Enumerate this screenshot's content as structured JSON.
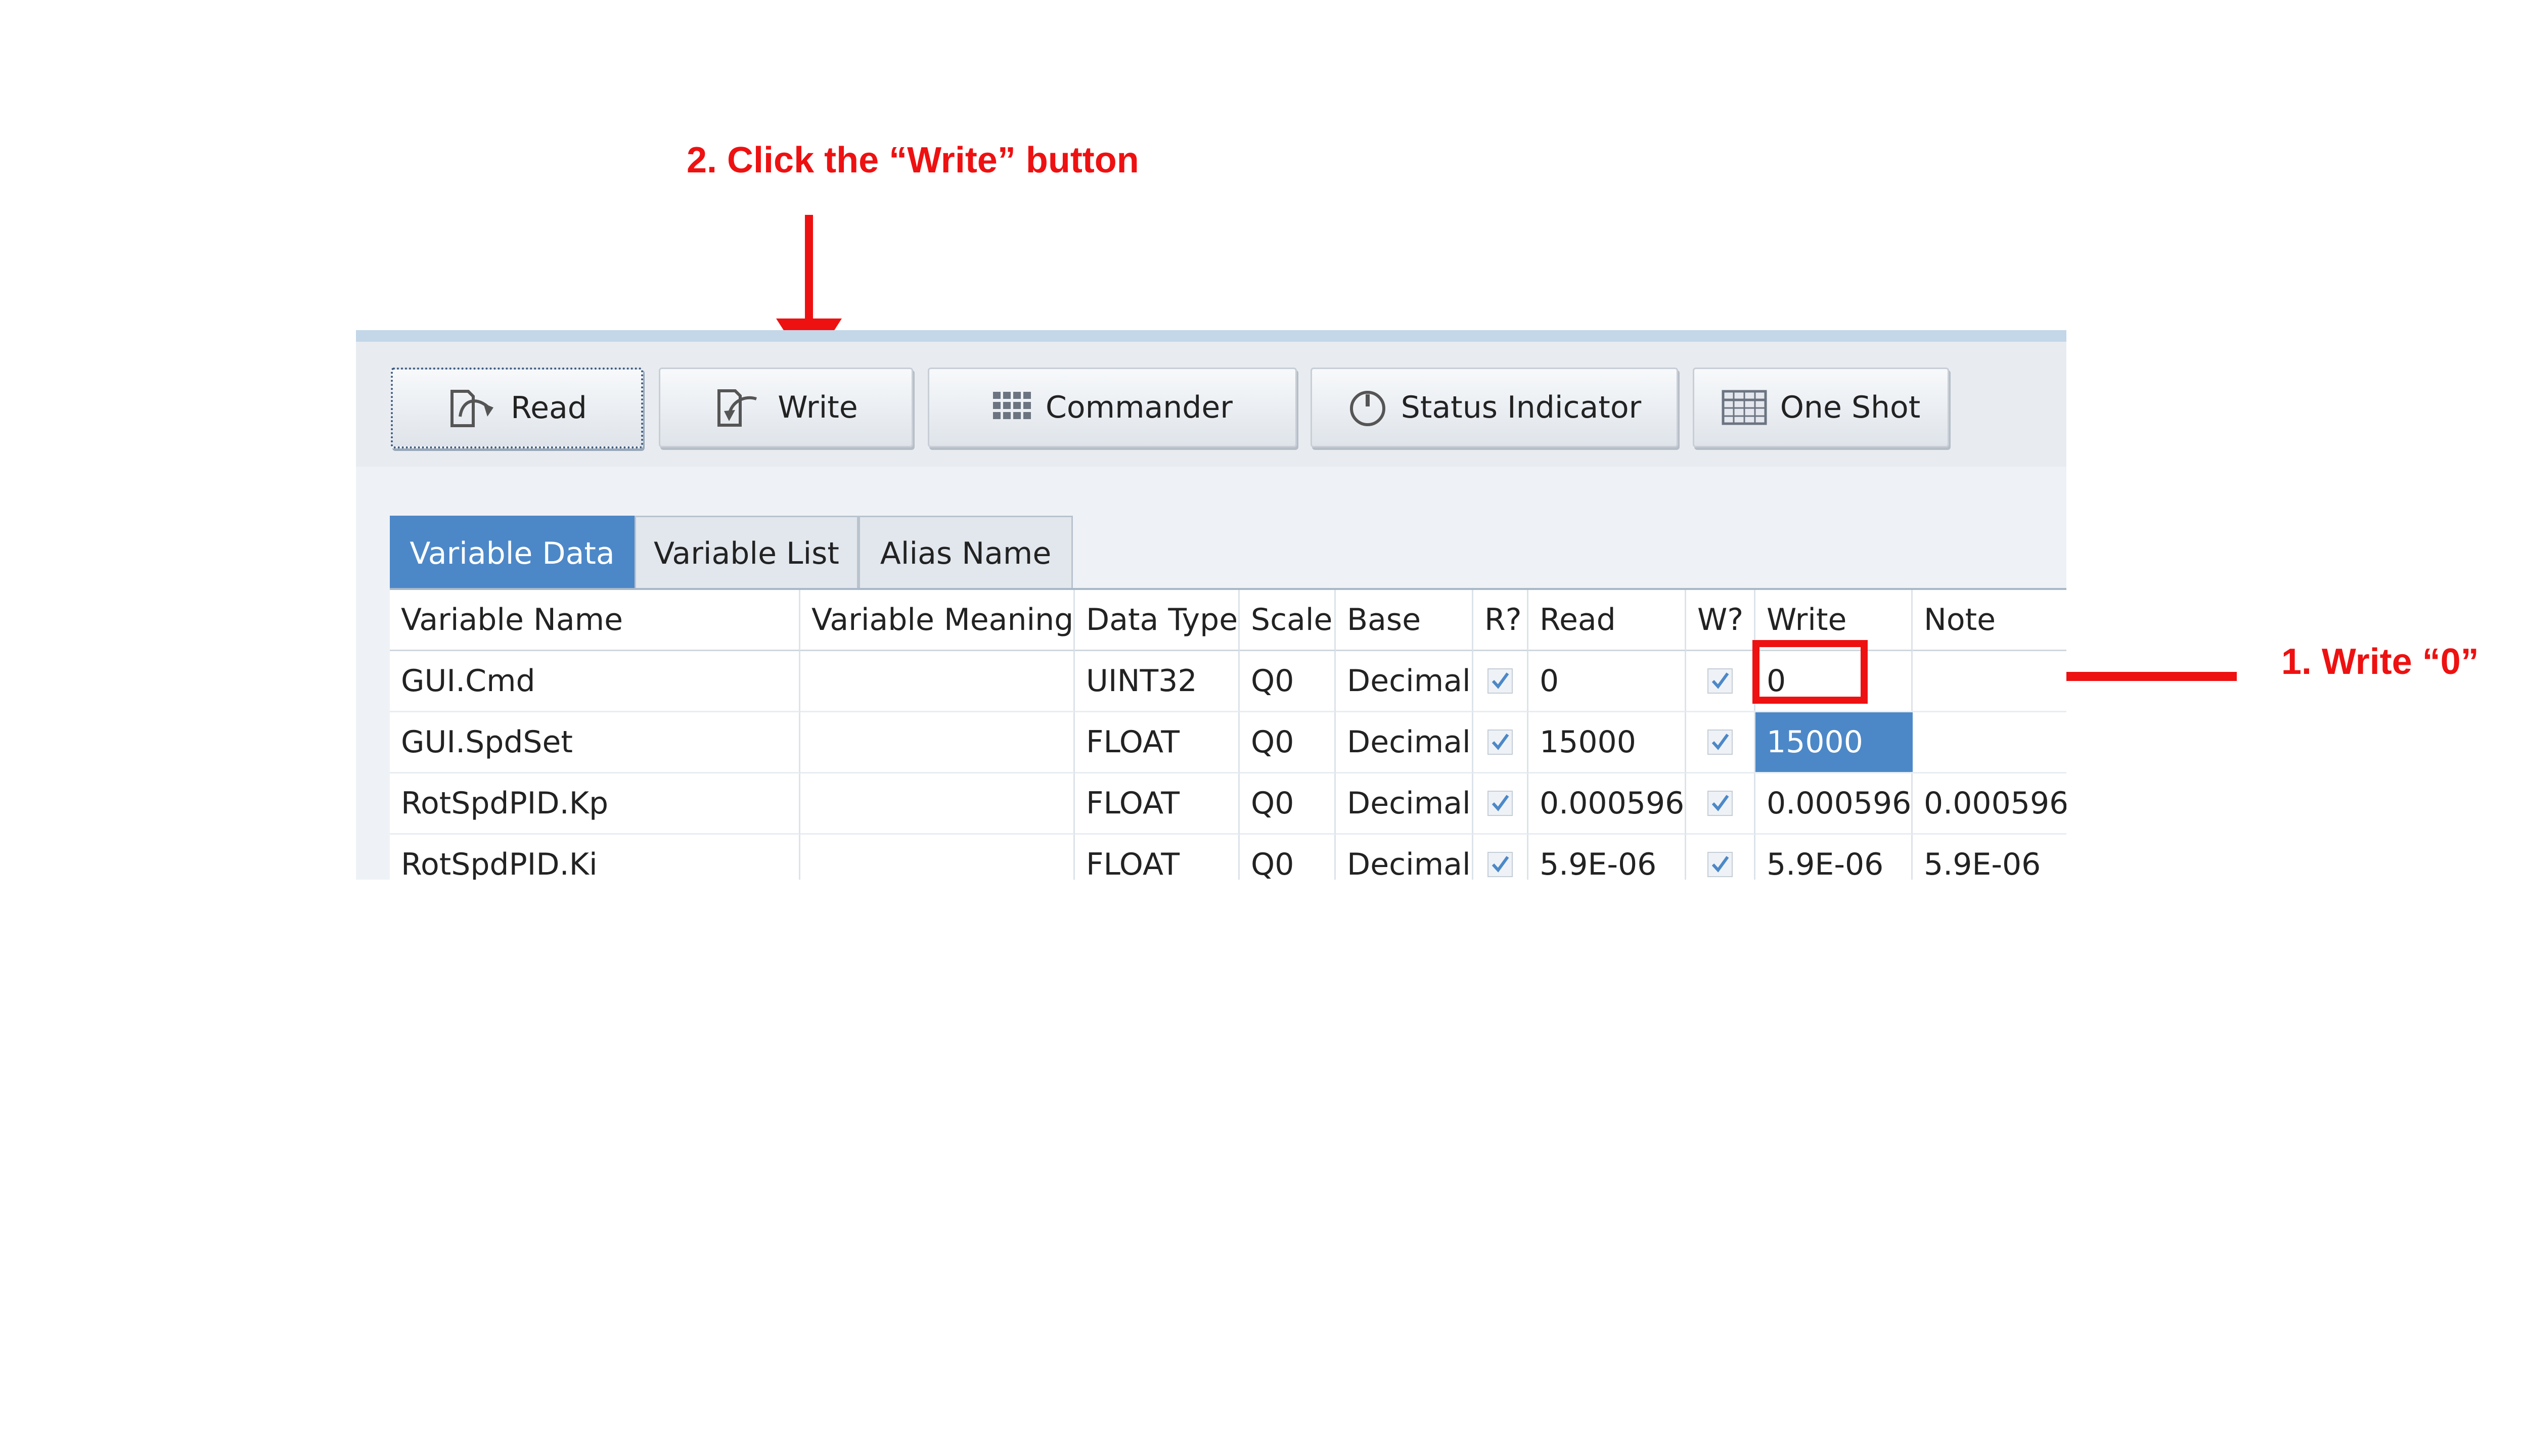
{
  "annotations": {
    "step2": "2. Click the “Write” button",
    "step1": "1. Write “0”"
  },
  "colors": {
    "accent": "#4c88c8",
    "annotation": "#ee1111",
    "topbar": "#c3d7e9"
  },
  "toolbar": {
    "buttons": [
      {
        "label": "Read",
        "icon": "read-icon"
      },
      {
        "label": "Write",
        "icon": "write-icon"
      },
      {
        "label": "Commander",
        "icon": "grid-icon"
      },
      {
        "label": "Status Indicator",
        "icon": "gauge-icon"
      },
      {
        "label": "One Shot",
        "icon": "table-icon"
      }
    ]
  },
  "tabs": [
    {
      "label": "Variable Data",
      "active": true
    },
    {
      "label": "Variable List",
      "active": false
    },
    {
      "label": "Alias Name",
      "active": false
    }
  ],
  "table": {
    "columns": [
      "Variable Name",
      "Variable Meaning",
      "Data Type",
      "Scale",
      "Base",
      "R?",
      "Read",
      "W?",
      "Write",
      "Note"
    ],
    "rows": [
      {
        "name": "GUI.Cmd",
        "meaning": "",
        "type": "UINT32",
        "scale": "Q0",
        "base": "Decimal",
        "r": true,
        "read": "0",
        "w": true,
        "write": "0",
        "note": ""
      },
      {
        "name": "GUI.SpdSet",
        "meaning": "",
        "type": "FLOAT",
        "scale": "Q0",
        "base": "Decimal",
        "r": true,
        "read": "15000",
        "w": true,
        "write": "15000",
        "note": ""
      },
      {
        "name": "RotSpdPID.Kp",
        "meaning": "",
        "type": "FLOAT",
        "scale": "Q0",
        "base": "Decimal",
        "r": true,
        "read": "0.000596",
        "w": true,
        "write": "0.000596",
        "note": "0.000596"
      },
      {
        "name": "RotSpdPID.Ki",
        "meaning": "",
        "type": "FLOAT",
        "scale": "Q0",
        "base": "Decimal",
        "r": true,
        "read": "5.9E-06",
        "w": true,
        "write": "5.9E-06",
        "note": "5.9E-06"
      }
    ]
  }
}
